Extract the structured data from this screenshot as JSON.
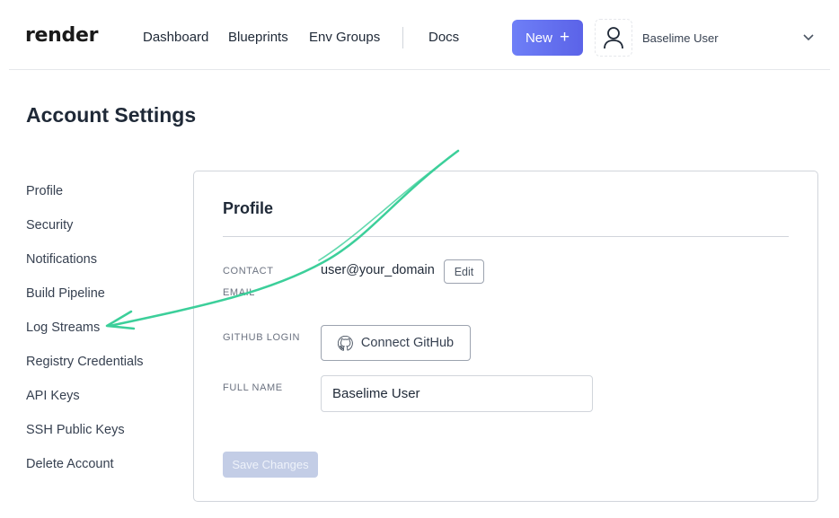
{
  "header": {
    "logo": "render",
    "nav": [
      "Dashboard",
      "Blueprints",
      "Env Groups"
    ],
    "docs": "Docs",
    "new_button": "New",
    "new_plus": "+",
    "user_name": "Baselime User"
  },
  "page": {
    "title": "Account Settings"
  },
  "sidebar": {
    "items": [
      {
        "label": "Profile"
      },
      {
        "label": "Security"
      },
      {
        "label": "Notifications"
      },
      {
        "label": "Build Pipeline"
      },
      {
        "label": "Log Streams"
      },
      {
        "label": "Registry Credentials"
      },
      {
        "label": "API Keys"
      },
      {
        "label": "SSH Public Keys"
      },
      {
        "label": "Delete Account"
      }
    ]
  },
  "profile": {
    "heading": "Profile",
    "contact_email_label": "CONTACT EMAIL",
    "contact_email_value": "user@your_domain",
    "edit_button": "Edit",
    "github_label": "GITHUB LOGIN",
    "github_button": "Connect GitHub",
    "full_name_label": "FULL NAME",
    "full_name_value": "Baselime User",
    "save_button": "Save Changes"
  },
  "colors": {
    "accent": "#6470ef",
    "annotation_arrow": "#3ccf9a",
    "save_disabled": "#c3cde6"
  },
  "icons": {
    "avatar": "user-icon",
    "chevron": "chevron-down-icon",
    "github": "github-icon",
    "annotation": "annotation-arrow"
  }
}
